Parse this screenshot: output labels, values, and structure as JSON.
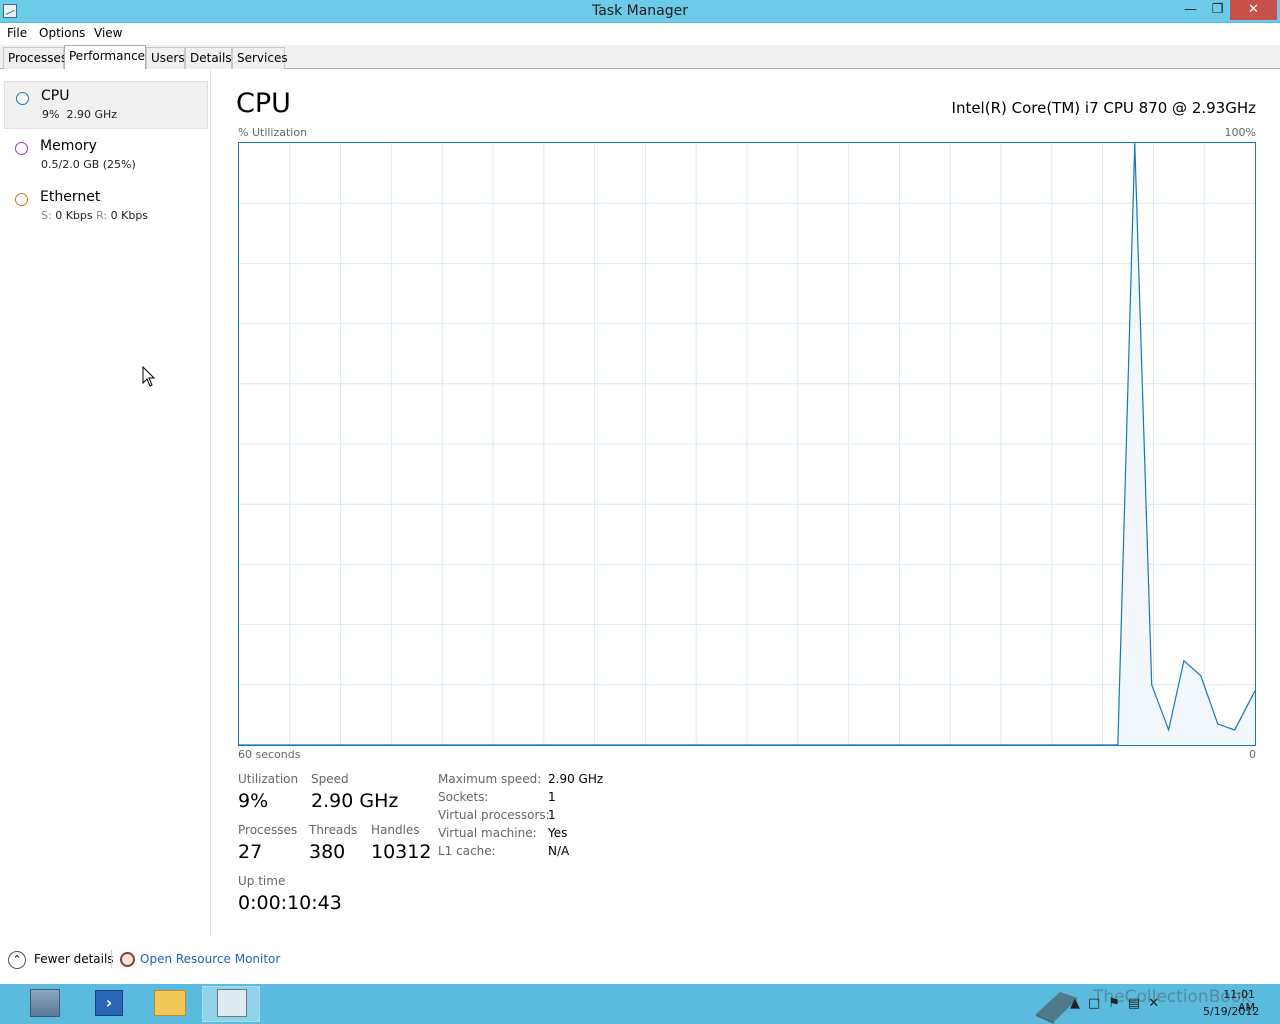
{
  "window": {
    "title": "Task Manager",
    "min_icon": "minimize-icon",
    "max_icon": "restore-icon",
    "close_icon": "close-icon"
  },
  "menu": [
    "File",
    "Options",
    "View"
  ],
  "tabs": [
    "Processes",
    "Performance",
    "Users",
    "Details",
    "Services"
  ],
  "active_tab": "Performance",
  "sidebar": {
    "items": [
      {
        "name": "CPU",
        "sub1": "9%",
        "sub2": "2.90 GHz",
        "color": "#1778b4"
      },
      {
        "name": "Memory",
        "sub1": "0.5/2.0 GB (25%)",
        "sub2": "",
        "color": "#a03cb4"
      },
      {
        "name": "Ethernet",
        "sub_s_label": "S:",
        "sub_s": "0 Kbps",
        "sub_r_label": "R:",
        "sub_r": "0 Kbps",
        "color": "#c5771a"
      }
    ]
  },
  "main": {
    "title": "CPU",
    "cpu_model": "Intel(R) Core(TM) i7 CPU 870 @ 2.93GHz",
    "axis_top_left": "% Utilization",
    "axis_top_right": "100%",
    "axis_bottom_left": "60 seconds",
    "axis_bottom_right": "0"
  },
  "chart_data": {
    "type": "area",
    "ylim": [
      0,
      100
    ],
    "xlim": [
      60,
      0
    ],
    "x": [
      60,
      8.1,
      7.1,
      6.1,
      5.1,
      4.2,
      3.2,
      2.2,
      1.2,
      0
    ],
    "values": [
      0,
      0,
      100,
      10,
      2.5,
      14,
      11.5,
      3.5,
      2.5,
      9
    ],
    "grid": true,
    "grid_columns": 20,
    "grid_rows": 10,
    "line_color": "#1778b4",
    "fill_color": "#f1f7fb",
    "grid_color": "#d9eaf5"
  },
  "stats": {
    "utilization_label": "Utilization",
    "utilization": "9%",
    "speed_label": "Speed",
    "speed": "2.90 GHz",
    "processes_label": "Processes",
    "processes": "27",
    "threads_label": "Threads",
    "threads": "380",
    "handles_label": "Handles",
    "handles": "10312",
    "uptime_label": "Up time",
    "uptime": "0:00:10:43"
  },
  "info": [
    {
      "label": "Maximum speed:",
      "value": "2.90 GHz"
    },
    {
      "label": "Sockets:",
      "value": "1"
    },
    {
      "label": "Virtual processors:",
      "value": "1"
    },
    {
      "label": "Virtual machine:",
      "value": "Yes"
    },
    {
      "label": "L1 cache:",
      "value": "N/A"
    }
  ],
  "footer": {
    "fewer_details": "Fewer details",
    "open_resource_monitor": "Open Resource Monitor"
  },
  "taskbar": {
    "apps": [
      "server-manager-icon",
      "powershell-icon",
      "file-explorer-icon",
      "task-manager-icon"
    ],
    "watermark": "TheCollectionBook",
    "time": "11:01 AM",
    "date": "5/19/2012"
  }
}
